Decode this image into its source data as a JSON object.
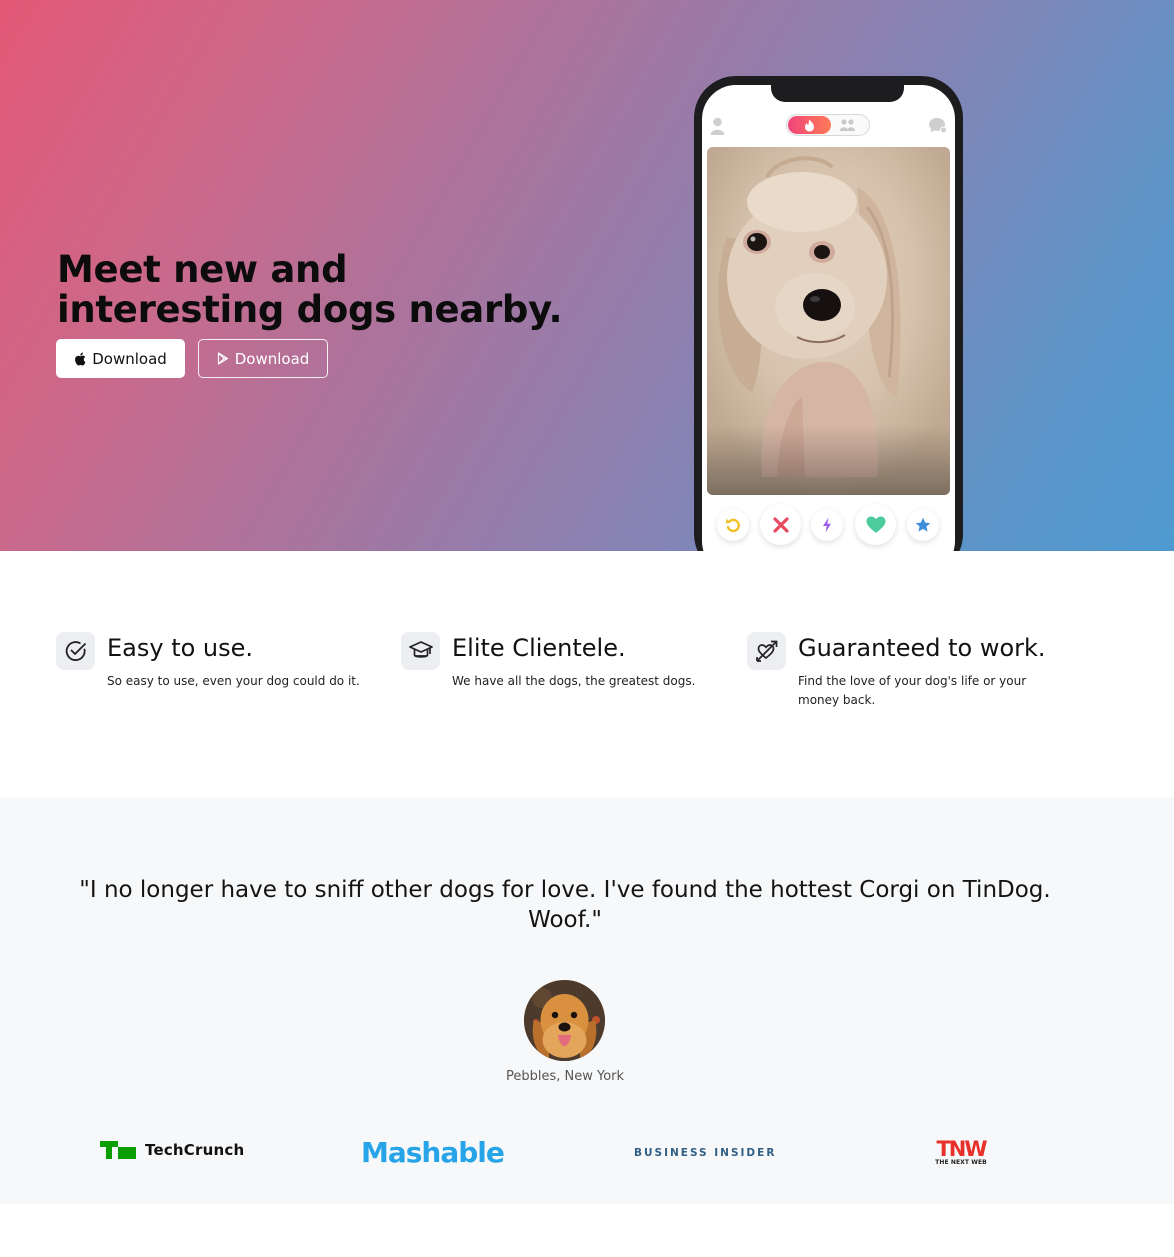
{
  "hero": {
    "title": "Meet new and interesting dogs nearby.",
    "buttons": [
      {
        "label": "Download",
        "icon": "apple-icon"
      },
      {
        "label": "Download",
        "icon": "google-play-icon"
      }
    ],
    "gradient": [
      "#e35876",
      "#4e9ad0"
    ]
  },
  "phone": {
    "icons": [
      "user-icon",
      "flame-icon",
      "group-icon",
      "chat-icon"
    ],
    "actions": [
      "rewind-icon",
      "nope-icon",
      "boost-icon",
      "like-icon",
      "super-like-icon"
    ],
    "action_colors": [
      "#f2c029",
      "#e84a5f",
      "#9b5de5",
      "#4ecb9d",
      "#3d8fdc"
    ]
  },
  "features": [
    {
      "icon": "check-circle-icon",
      "title": "Easy to use.",
      "text": "So easy to use, even your dog could do it."
    },
    {
      "icon": "graduation-cap-icon",
      "title": "Elite Clientele.",
      "text": "We have all the dogs, the greatest dogs."
    },
    {
      "icon": "heart-arrow-icon",
      "title": "Guaranteed to work.",
      "text": "Find the love of your dog's life or your money back."
    }
  ],
  "testimonial": {
    "quote": "\"I no longer have to sniff other dogs for love. I've found the hottest Corgi on TinDog. Woof.\"",
    "author": "Pebbles, New York"
  },
  "press": {
    "techcrunch": "TechCrunch",
    "mashable": "Mashable",
    "business_insider": "BUSINESS INSIDER",
    "tnw_big": "TNW",
    "tnw_small": "THE NEXT WEB"
  }
}
